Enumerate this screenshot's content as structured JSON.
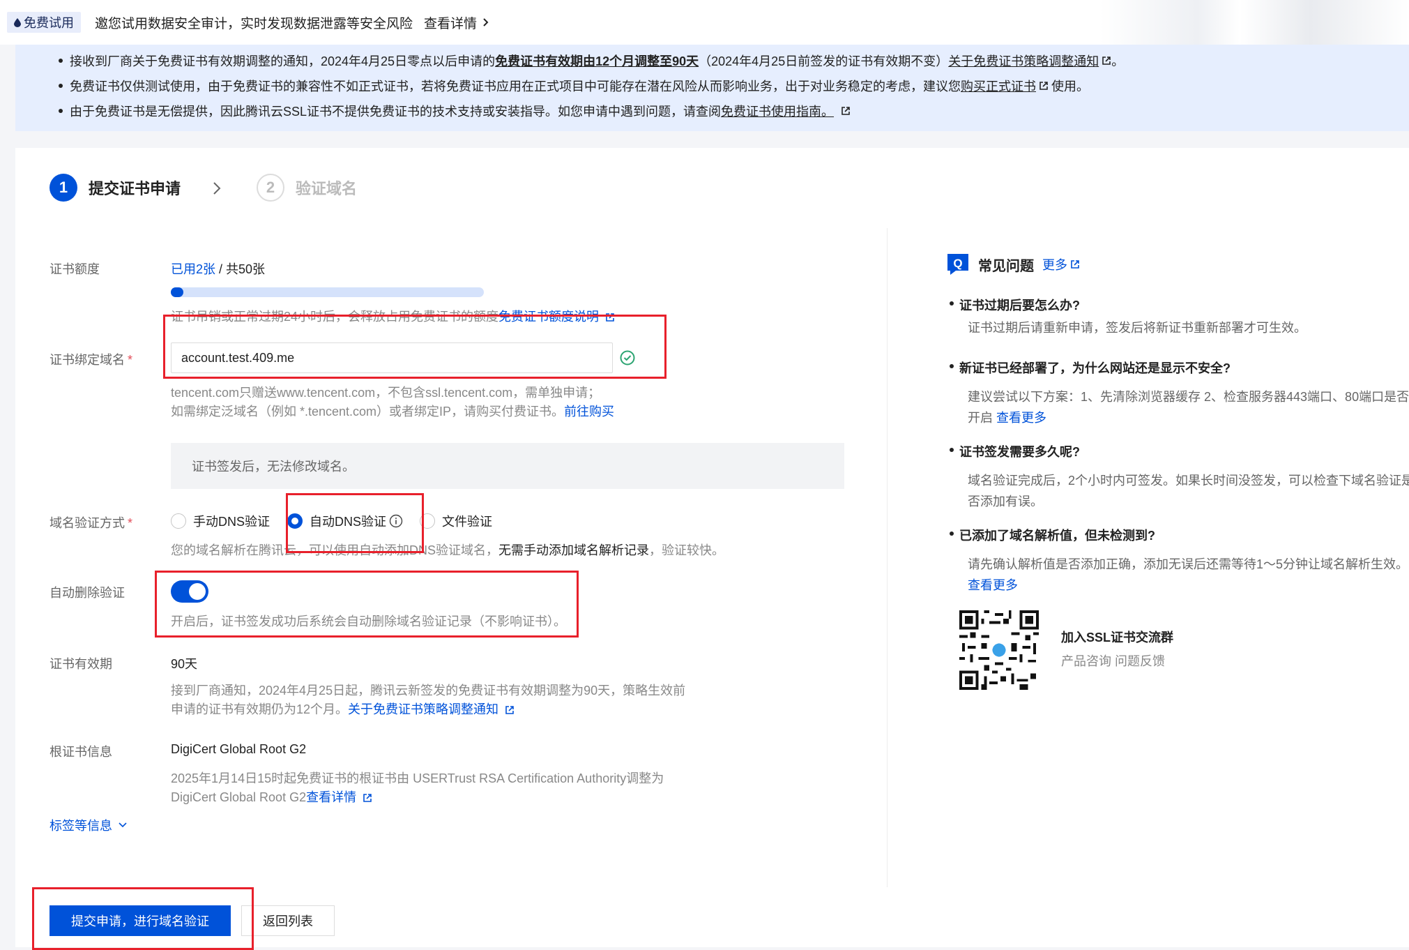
{
  "promo": {
    "tag": "免费试用",
    "message": "邀您试用数据安全审计，实时发现数据泄露等安全风险",
    "more": "查看详情"
  },
  "notice": {
    "line1_pre": "接收到厂商关于免费证书有效期调整的通知，2024年4月25日零点以后申请的",
    "line1_bold": "免费证书有效期由12个月调整至90天",
    "line1_mid": "（2024年4月25日前签发的证书有效期不变）",
    "line1_link": "关于免费证书策略调整通知",
    "line1_end": "。",
    "line2_pre": "免费证书仅供测试使用，由于免费证书的兼容性不如正式证书，若将免费证书应用在正式项目中可能存在潜在风险从而影响业务，出于对业务稳定的考虑，建议您",
    "line2_link": "购买正式证书",
    "line2_end": "使用。",
    "line3_pre": "由于免费证书是无偿提供，因此腾讯云SSL证书不提供免费证书的技术支持或安装指导。如您申请中遇到问题，请查阅",
    "line3_link": "免费证书使用指南。"
  },
  "steps": [
    {
      "num": "1",
      "label": "提交证书申请"
    },
    {
      "num": "2",
      "label": "验证域名"
    }
  ],
  "form": {
    "quota": {
      "label": "证书额度",
      "used": "已用2张",
      "total": " / 共50张",
      "progress_fraction": 0.04,
      "hint": "证书吊销或正常过期24小时后，会释放占用免费证书的额度",
      "hint_link": "免费证书额度说明"
    },
    "domain": {
      "label": "证书绑定域名",
      "required": "*",
      "value": "account.test.409.me",
      "hint1": "tencent.com只赠送www.tencent.com，不包含ssl.tencent.com，需单独申请；",
      "hint2": "如需绑定泛域名（例如 *.tencent.com）或者绑定IP，请购买付费证书。",
      "hint2_link": "前往购买",
      "locked_note": "证书签发后，无法修改域名。"
    },
    "verify": {
      "label": "域名验证方式",
      "required": "*",
      "options": [
        "手动DNS验证",
        "自动DNS验证",
        "文件验证"
      ],
      "selected": "自动DNS验证",
      "hint_pre": "您的域名解析在腾讯云，可以使用自动添加DNS验证域名，",
      "hint_bold": "无需手动添加域名解析记录",
      "hint_end": "，验证较快。"
    },
    "auto_delete": {
      "label": "自动删除验证",
      "enabled": true,
      "hint": "开启后，证书签发成功后系统会自动删除域名验证记录（不影响证书）。"
    },
    "validity": {
      "label": "证书有效期",
      "value": "90天",
      "hint1": "接到厂商通知，2024年4月25日起，腾讯云新签发的免费证书有效期调整为90天，策略生效前",
      "hint2": "申请的证书有效期仍为12个月。",
      "hint2_link": "关于免费证书策略调整通知"
    },
    "root": {
      "label": "根证书信息",
      "value": "DigiCert Global Root G2",
      "hint1": "2025年1月14日15时起免费证书的根证书由 USERTrust RSA Certification Authority调整为",
      "hint2": "DigiCert Global Root G2",
      "hint2_link": "查看详情"
    },
    "more_info": "标签等信息"
  },
  "buttons": {
    "submit": "提交申请，进行域名验证",
    "back": "返回列表"
  },
  "faq": {
    "icon_letter": "Q",
    "title": "常见问题",
    "more": "更多",
    "items": [
      {
        "q": "证书过期后要怎么办?",
        "a": "证书过期后请重新申请，签发后将新证书重新部署才可生效。"
      },
      {
        "q": "新证书已经部署了，为什么网站还是显示不安全?",
        "a": "建议尝试以下方案：1、先清除浏览器缓存 2、检查服务器443端口、80端口是否开启",
        "link": "查看更多"
      },
      {
        "q": "证书签发需要多久呢?",
        "a": "域名验证完成后，2个小时内可签发。如果长时间没签发，可以检查下域名验证是否添加有误。"
      },
      {
        "q": "已添加了域名解析值，但未检测到?",
        "a": "请先确认解析值是否添加正确，添加无误后还需等待1～5分钟让域名解析生效。",
        "link": "查看更多"
      }
    ],
    "group_title": "加入SSL证书交流群",
    "group_sub": "产品咨询 问题反馈"
  },
  "colors": {
    "brand": "#0052d9",
    "highlight": "#e8202b",
    "success": "#2ba471"
  }
}
